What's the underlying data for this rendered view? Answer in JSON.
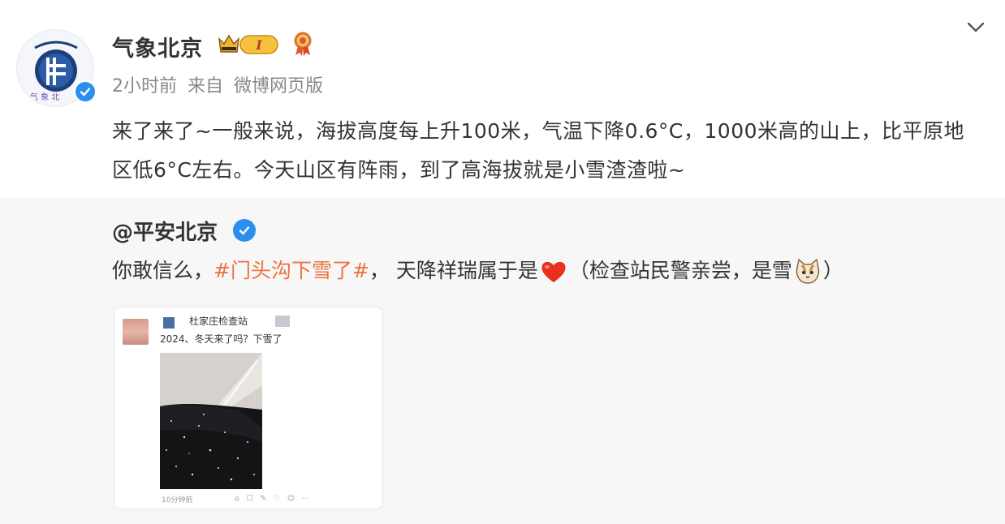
{
  "author": {
    "name": "气象北京",
    "time": "2小时前",
    "source_prefix": "来自",
    "source": "微博网页版"
  },
  "post": {
    "text": "来了来了~一般来说，海拔高度每上升100米，气温下降0.6°C，1000米高的山上，比平原地区低6°C左右。今天山区有阵雨，到了高海拔就是小雪渣渣啦~"
  },
  "retweet": {
    "name": "@平安北京",
    "text_before": "你敢信么，",
    "hashtag": "#门头沟下雪了#",
    "text_middle": "， 天降祥瑞属于是",
    "text_after": "（检查站民警亲尝，是雪",
    "text_end": "）",
    "image": {
      "author": "杜家庄检查站",
      "caption": "2024、冬天来了吗？下雪了",
      "time": "10分钟前"
    }
  },
  "icons": {
    "collapse": "chevron-down-icon",
    "verified": "verified-check-icon",
    "vip": "vip-crown-badge-icon",
    "medal": "medal-icon",
    "heart": "red-heart-emoji",
    "cat": "cat-face-emoji"
  },
  "colors": {
    "hashtag": "#eb7340",
    "verified": "#2c8ff0",
    "vip": "#f0a020",
    "retweet_bg": "#f7f7f7"
  }
}
